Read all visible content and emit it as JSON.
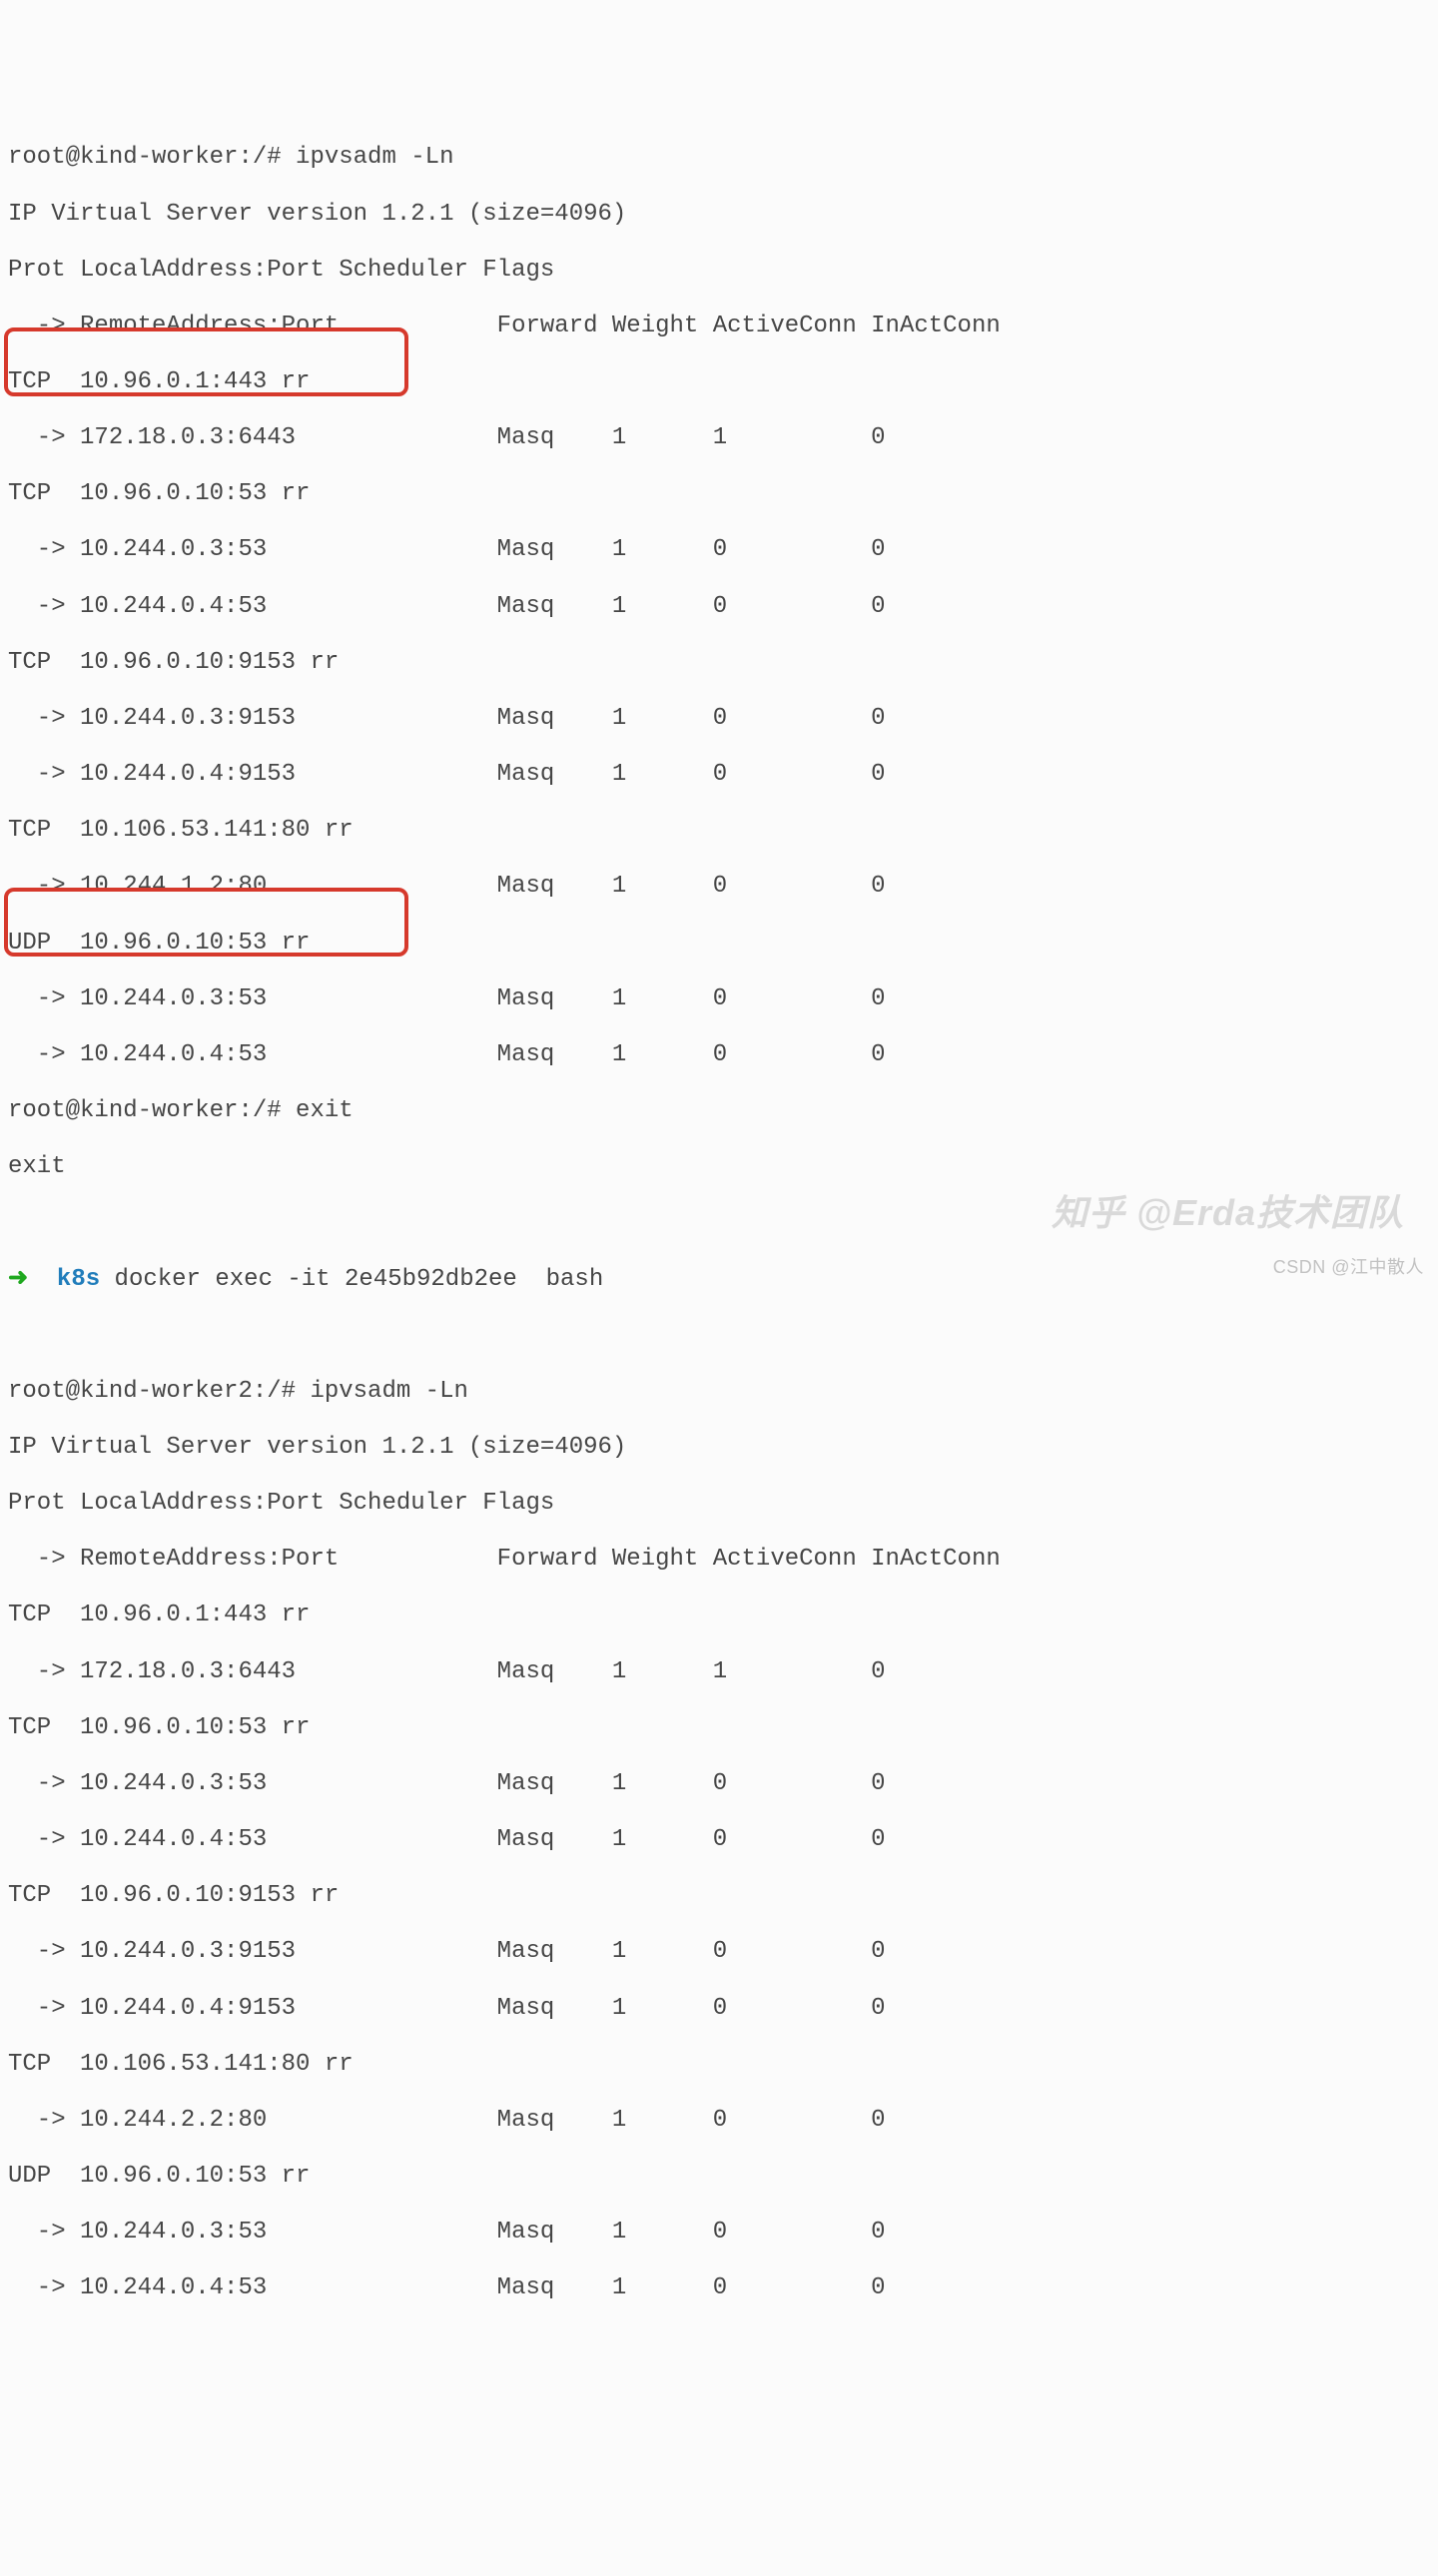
{
  "sessions": [
    {
      "prompt": "root@kind-worker:/# ipvsadm -Ln",
      "header1": "IP Virtual Server version 1.2.1 (size=4096)",
      "header2": "Prot LocalAddress:Port Scheduler Flags",
      "header3": "  -> RemoteAddress:Port           Forward Weight ActiveConn InActConn",
      "rules": [
        "TCP  10.96.0.1:443 rr",
        "  -> 172.18.0.3:6443              Masq    1      1          0",
        "TCP  10.96.0.10:53 rr",
        "  -> 10.244.0.3:53                Masq    1      0          0",
        "  -> 10.244.0.4:53                Masq    1      0          0",
        "TCP  10.96.0.10:9153 rr",
        "  -> 10.244.0.3:9153              Masq    1      0          0",
        "  -> 10.244.0.4:9153              Masq    1      0          0",
        "TCP  10.106.53.141:80 rr",
        "  -> 10.244.1.2:80                Masq    1      0          0",
        "UDP  10.96.0.10:53 rr",
        "  -> 10.244.0.3:53                Masq    1      0          0",
        "  -> 10.244.0.4:53                Masq    1      0          0"
      ],
      "exit_prompt": "root@kind-worker:/# exit",
      "exit_echo": "exit"
    },
    {
      "docker_arrow": "➜",
      "docker_dir": "k8s",
      "docker_cmd": " docker exec -it 2e45b92db2ee  bash",
      "prompt": "root@kind-worker2:/# ipvsadm -Ln",
      "header1": "IP Virtual Server version 1.2.1 (size=4096)",
      "header2": "Prot LocalAddress:Port Scheduler Flags",
      "header3": "  -> RemoteAddress:Port           Forward Weight ActiveConn InActConn",
      "rules": [
        "TCP  10.96.0.1:443 rr",
        "  -> 172.18.0.3:6443              Masq    1      1          0",
        "TCP  10.96.0.10:53 rr",
        "  -> 10.244.0.3:53                Masq    1      0          0",
        "  -> 10.244.0.4:53                Masq    1      0          0",
        "TCP  10.96.0.10:9153 rr",
        "  -> 10.244.0.3:9153              Masq    1      0          0",
        "  -> 10.244.0.4:9153              Masq    1      0          0",
        "TCP  10.106.53.141:80 rr",
        "  -> 10.244.2.2:80                Masq    1      0          0",
        "UDP  10.96.0.10:53 rr",
        "  -> 10.244.0.3:53                Masq    1      0          0",
        "  -> 10.244.0.4:53                Masq    1      0          0"
      ]
    }
  ],
  "watermarks": {
    "zhihu": "知乎 @Erda技术团队",
    "csdn": "CSDN @江中散人"
  }
}
